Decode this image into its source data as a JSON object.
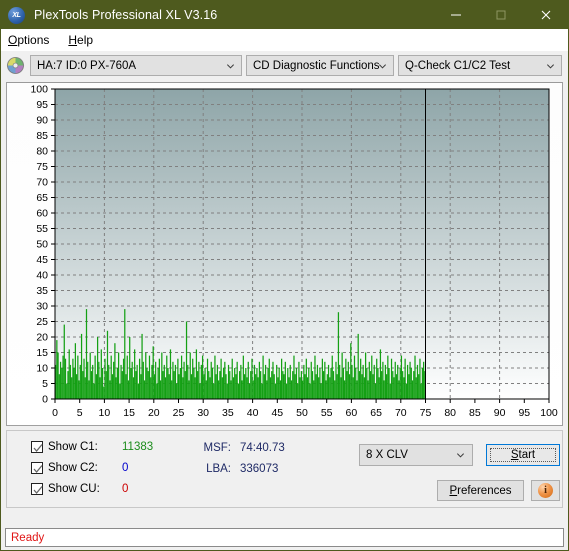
{
  "window": {
    "title": "PlexTools Professional XL V3.16",
    "logo_text": "XL",
    "minimize_label": "minimize",
    "maximize_label": "maximize",
    "close_label": "close"
  },
  "menu": {
    "items": [
      {
        "label": "Options",
        "accel": "O",
        "rest": "ptions"
      },
      {
        "label": "Help",
        "accel": "H",
        "rest": "elp"
      }
    ]
  },
  "toolbar": {
    "drive_combo": "HA:7 ID:0  PX-760A",
    "function_combo": "CD Diagnostic Functions",
    "test_combo": "Q-Check C1/C2 Test",
    "disc_icon": "disc-icon"
  },
  "chart_data": {
    "type": "bar",
    "title": "",
    "xlabel": "",
    "ylabel": "",
    "xlim": [
      0,
      100
    ],
    "ylim": [
      0,
      100
    ],
    "xticks": [
      0,
      5,
      10,
      15,
      20,
      25,
      30,
      35,
      40,
      45,
      50,
      55,
      60,
      65,
      70,
      75,
      80,
      85,
      90,
      95,
      100
    ],
    "yticks": [
      0,
      5,
      10,
      15,
      20,
      25,
      30,
      35,
      40,
      45,
      50,
      55,
      60,
      65,
      70,
      75,
      80,
      85,
      90,
      95,
      100
    ],
    "grid": true,
    "legend": null,
    "series": [
      {
        "name": "C1",
        "color": "#14a014",
        "data_end_x": 75,
        "values": [
          11,
          19,
          15,
          8,
          12,
          10,
          14,
          24,
          13,
          5,
          9,
          16,
          11,
          7,
          13,
          10,
          18,
          8,
          14,
          6,
          11,
          21,
          9,
          13,
          7,
          29,
          12,
          6,
          15,
          9,
          11,
          5,
          14,
          8,
          20,
          12,
          7,
          16,
          10,
          4,
          13,
          9,
          22,
          11,
          6,
          14,
          8,
          12,
          18,
          7,
          10,
          15,
          5,
          11,
          9,
          13,
          29,
          8,
          14,
          6,
          20,
          10,
          12,
          7,
          16,
          9,
          11,
          5,
          13,
          8,
          21,
          12,
          6,
          15,
          10,
          9,
          14,
          7,
          11,
          17,
          8,
          12,
          5,
          10,
          13,
          6,
          15,
          9,
          11,
          7,
          14,
          10,
          8,
          16,
          6,
          12,
          9,
          11,
          5,
          13,
          8,
          10,
          14,
          7,
          12,
          9,
          25,
          11,
          6,
          15,
          8,
          13,
          10,
          7,
          16,
          9,
          12,
          5,
          11,
          14,
          8,
          10,
          6,
          13,
          9,
          7,
          12,
          10,
          5,
          14,
          8,
          11,
          6,
          9,
          13,
          7,
          10,
          12,
          8,
          5,
          11,
          9,
          6,
          13,
          7,
          10,
          8,
          12,
          5,
          9,
          11,
          6,
          14,
          8,
          10,
          7,
          12,
          5,
          9,
          13,
          6,
          11,
          8,
          10,
          7,
          12,
          9,
          5,
          14,
          8,
          11,
          6,
          10,
          13,
          7,
          9,
          12,
          8,
          5,
          11,
          7,
          10,
          6,
          13,
          9,
          8,
          12,
          5,
          10,
          7,
          11,
          6,
          9,
          14,
          8,
          10,
          5,
          12,
          7,
          9,
          6,
          11,
          8,
          13,
          7,
          10,
          5,
          12,
          9,
          6,
          14,
          8,
          11,
          7,
          10,
          5,
          13,
          9,
          12,
          6,
          8,
          11,
          7,
          10,
          14,
          9,
          6,
          12,
          8,
          28,
          11,
          7,
          15,
          10,
          6,
          13,
          9,
          12,
          8,
          18,
          11,
          7,
          14,
          10,
          6,
          21,
          9,
          13,
          8,
          11,
          7,
          15,
          10,
          6,
          12,
          9,
          14,
          8,
          11,
          5,
          13,
          10,
          7,
          16,
          9,
          12,
          6,
          11,
          8,
          14,
          10,
          5,
          13,
          9,
          7,
          12,
          8,
          11,
          6,
          10,
          14,
          9,
          7,
          13,
          5,
          11,
          8,
          12,
          10,
          6,
          9,
          14,
          7,
          11,
          8,
          13,
          5,
          10,
          12,
          9
        ]
      },
      {
        "name": "C2",
        "color": "#0000cc",
        "values": []
      },
      {
        "name": "CU",
        "color": "#cc0000",
        "values": []
      }
    ],
    "end_marker_x": 75,
    "plot_bg_top": "#8ea5a8",
    "plot_bg_bottom": "#ffffff"
  },
  "controls": {
    "checkboxes": [
      {
        "label": "Show C1:",
        "checked": true,
        "value": "11383",
        "color": "#1c8c1c"
      },
      {
        "label": "Show C2:",
        "checked": true,
        "value": "0",
        "color": "#0000cc"
      },
      {
        "label": "Show CU:",
        "checked": true,
        "value": "0",
        "color": "#cc0000"
      }
    ],
    "msf_label": "MSF:",
    "msf_value": "74:40.73",
    "lba_label": "LBA:",
    "lba_value": "336073",
    "speed_combo": "8 X CLV",
    "start_label": "Start",
    "start_accel": "S",
    "start_rest": "tart",
    "preferences_label": "Preferences",
    "preferences_accel": "P",
    "preferences_rest": "references",
    "info_button_glyph": "i",
    "info_button_name": "info-icon"
  },
  "status": {
    "text": "Ready",
    "color": "#e01414"
  }
}
